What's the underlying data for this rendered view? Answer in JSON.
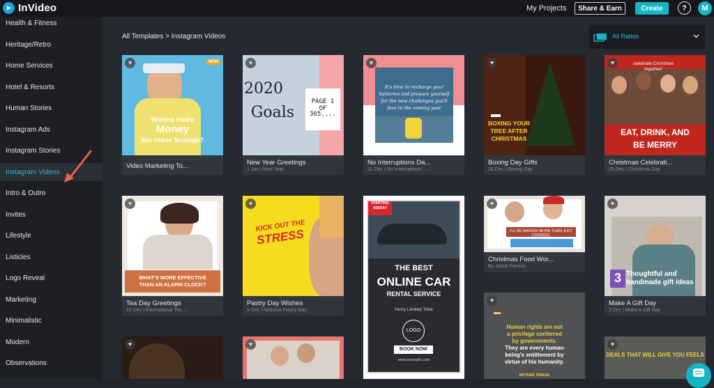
{
  "app": {
    "name": "InVideo"
  },
  "header": {
    "my_projects": "My Projects",
    "share_earn": "Share & Earn",
    "create": "Create",
    "help": "?",
    "avatar_initial": "M"
  },
  "sidebar": {
    "items": [
      {
        "label": "Health & Fitness"
      },
      {
        "label": "Heritage/Retro"
      },
      {
        "label": "Home Services"
      },
      {
        "label": "Hotel & Resorts"
      },
      {
        "label": "Human Stories"
      },
      {
        "label": "Instagram Ads"
      },
      {
        "label": "Instagram Stories"
      },
      {
        "label": "Instagram Videos",
        "active": true
      },
      {
        "label": "Intro & Outro"
      },
      {
        "label": "Invites"
      },
      {
        "label": "Lifestyle"
      },
      {
        "label": "Listicles"
      },
      {
        "label": "Logo Reveal"
      },
      {
        "label": "Marketing"
      },
      {
        "label": "Minimalistic"
      },
      {
        "label": "Modern"
      },
      {
        "label": "Observations"
      }
    ]
  },
  "breadcrumb": "All Templates > Instagram Videos",
  "ratio_filter": {
    "label": "All Ratios"
  },
  "cards": {
    "c1": {
      "title": "Video Marketing To...",
      "sub": "",
      "badge": "NEW",
      "overlay": [
        "Wonna make",
        "Money",
        "like Uncle $croogе?"
      ]
    },
    "c2": {
      "title": "New Year Greetings",
      "sub": "1 Jan | New Year",
      "overlay": [
        "2020",
        "Goals",
        "PAGE 1 OF",
        "365...."
      ]
    },
    "c3": {
      "title": "No Interruptions Da...",
      "sub": "31 Dec | No Interruptions ...",
      "overlay": [
        "It's time to recharge your",
        "batteries and prepare yourself",
        "for the new challenges you'll",
        "face in the coming year"
      ]
    },
    "c4": {
      "title": "Boxing Day Gifts",
      "sub": "26 Dec | Boxing Day",
      "overlay": [
        "BOXING YOUR",
        "TREE AFTER",
        "CHRISTMAS"
      ]
    },
    "c5": {
      "title": "Christmas Celebrati...",
      "sub": "25 Dec | Christmas Day",
      "overlay": [
        "celebrate Christmas",
        "together!",
        "EAT, DRINK, AND",
        "BE MERRY"
      ]
    },
    "c6": {
      "title": "Tea Day Greetings",
      "sub": "15 Dec | International Tea ...",
      "overlay": [
        "WHAT'S MORE EFFECTIVE",
        "THAN AN ALARM CLOCK?"
      ]
    },
    "c7": {
      "title": "Pastry Day Wishes",
      "sub": "9 Dec | National Pastry Day",
      "overlay": [
        "KICK OUT THE",
        "STRESS"
      ]
    },
    "c8": {
      "overlay": [
        "STARTING",
        "49$/DAY",
        "THE BEST",
        "ONLINE CAR",
        "RENTAL SERVICE",
        "Hurry Limited Time",
        "LOGO",
        "BOOK NOW",
        "www.example.com"
      ]
    },
    "c9": {
      "title": "Christmas Food Wor...",
      "sub": "By Jamie Pierson",
      "overlay": [
        "I'LL BE MAKING MORE THAN JUST COOKIES."
      ]
    },
    "c10": {
      "title": "Make A Gift Day",
      "sub": "3 Dec | Make a Gift Day",
      "overlay": [
        "3",
        "Thoughtful and",
        "handmade gift ideas"
      ]
    },
    "c11": {
      "overlay": [
        "Human rights are not",
        "a privilege conferred",
        "by governments.",
        "They are every human",
        "being's entitlement by",
        "virtue of his humanity.",
        "MOTHER TERESA"
      ]
    },
    "c12": {
      "overlay": [
        "DEALS THAT WILL GIVE YOU FEELS"
      ]
    }
  },
  "colors": {
    "accent": "#14b6c6",
    "active_text": "#1fc0d3",
    "arrow": "#e8604c"
  },
  "icons": {
    "heart": "heart-icon",
    "help": "help-icon",
    "chevron": "chevron-down-icon",
    "ratio": "aspect-ratio-icon",
    "chat": "chat-icon"
  }
}
